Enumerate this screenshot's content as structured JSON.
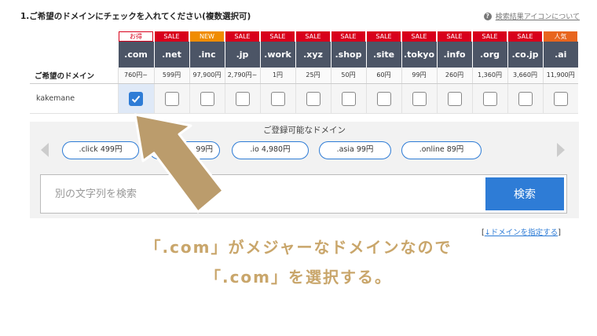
{
  "header": {
    "title": "1.ご希望のドメインにチェックを入れてください(複数選択可)",
    "help_icon": "question-circle-icon",
    "help_link": "検索結果アイコンについて"
  },
  "table": {
    "row_label": "ご希望のドメイン",
    "domain_name": "kakemane",
    "columns": [
      {
        "badge": "お得",
        "badge_type": "otoku",
        "tld": ".com",
        "price": "760円~",
        "checked": true
      },
      {
        "badge": "SALE",
        "badge_type": "sale",
        "tld": ".net",
        "price": "599円",
        "checked": false
      },
      {
        "badge": "NEW",
        "badge_type": "new",
        "tld": ".inc",
        "price": "97,900円",
        "checked": false
      },
      {
        "badge": "SALE",
        "badge_type": "sale",
        "tld": ".jp",
        "price": "2,790円~",
        "checked": false
      },
      {
        "badge": "SALE",
        "badge_type": "sale",
        "tld": ".work",
        "price": "1円",
        "checked": false
      },
      {
        "badge": "SALE",
        "badge_type": "sale",
        "tld": ".xyz",
        "price": "25円",
        "checked": false
      },
      {
        "badge": "SALE",
        "badge_type": "sale",
        "tld": ".shop",
        "price": "50円",
        "checked": false
      },
      {
        "badge": "SALE",
        "badge_type": "sale",
        "tld": ".site",
        "price": "60円",
        "checked": false
      },
      {
        "badge": "SALE",
        "badge_type": "sale",
        "tld": ".tokyo",
        "price": "99円",
        "checked": false
      },
      {
        "badge": "SALE",
        "badge_type": "sale",
        "tld": ".info",
        "price": "260円",
        "checked": false
      },
      {
        "badge": "SALE",
        "badge_type": "sale",
        "tld": ".org",
        "price": "1,360円",
        "checked": false
      },
      {
        "badge": "SALE",
        "badge_type": "sale",
        "tld": ".co.jp",
        "price": "3,660円",
        "checked": false
      },
      {
        "badge": "人気",
        "badge_type": "ninki",
        "tld": ".ai",
        "price": "11,900円",
        "checked": false
      }
    ]
  },
  "suggest": {
    "title": "ご登録可能なドメイン",
    "items": [
      {
        "label": ".click 499円"
      },
      {
        "label": "99円"
      },
      {
        "label": ".io 4,980円"
      },
      {
        "label": ".asia 99円"
      },
      {
        "label": ".online 89円"
      }
    ]
  },
  "search": {
    "placeholder": "別の文字列を検索",
    "button_label": "検索"
  },
  "specify": {
    "open": "[",
    "link": "↓ドメインを指定する",
    "close": "]"
  },
  "annotation": {
    "line1": "「.com」がメジャーなドメインなので",
    "line2": "「.com」を選択する。",
    "arrow_color": "#bb9c6c",
    "caption_color": "#c9a66b"
  }
}
